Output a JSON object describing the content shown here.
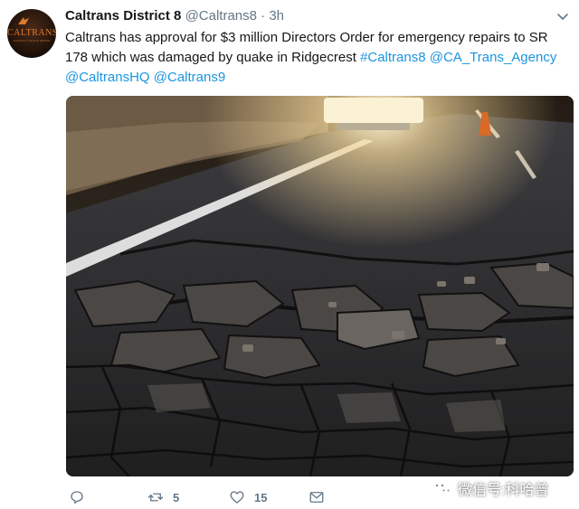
{
  "tweet": {
    "display_name": "Caltrans District 8",
    "handle": "@Caltrans8",
    "separator": "·",
    "time": "3h",
    "text_part1": "Caltrans has approval for $3 million Directors Order for emergency repairs to SR 178 which was damaged by quake in Ridgecrest ",
    "hashtag": "#Caltrans8",
    "mention1": "@CA_Trans_Agency",
    "mention2": "@CaltransHQ",
    "mention3": "@Caltrans9"
  },
  "avatar": {
    "logo_text": "CALTRANS",
    "logo_subtext": "DISTRICT 8 INLAND EMPIRE"
  },
  "actions": {
    "reply_icon": "reply-icon",
    "retweet_icon": "retweet-icon",
    "retweet_count": "5",
    "like_icon": "heart-icon",
    "like_count": "15",
    "share_icon": "mail-icon"
  },
  "watermark": {
    "text": "微信号:科哈普"
  },
  "colors": {
    "link": "#1b95e0",
    "muted": "#657786",
    "text": "#14171a",
    "logo": "#e07a2a"
  }
}
